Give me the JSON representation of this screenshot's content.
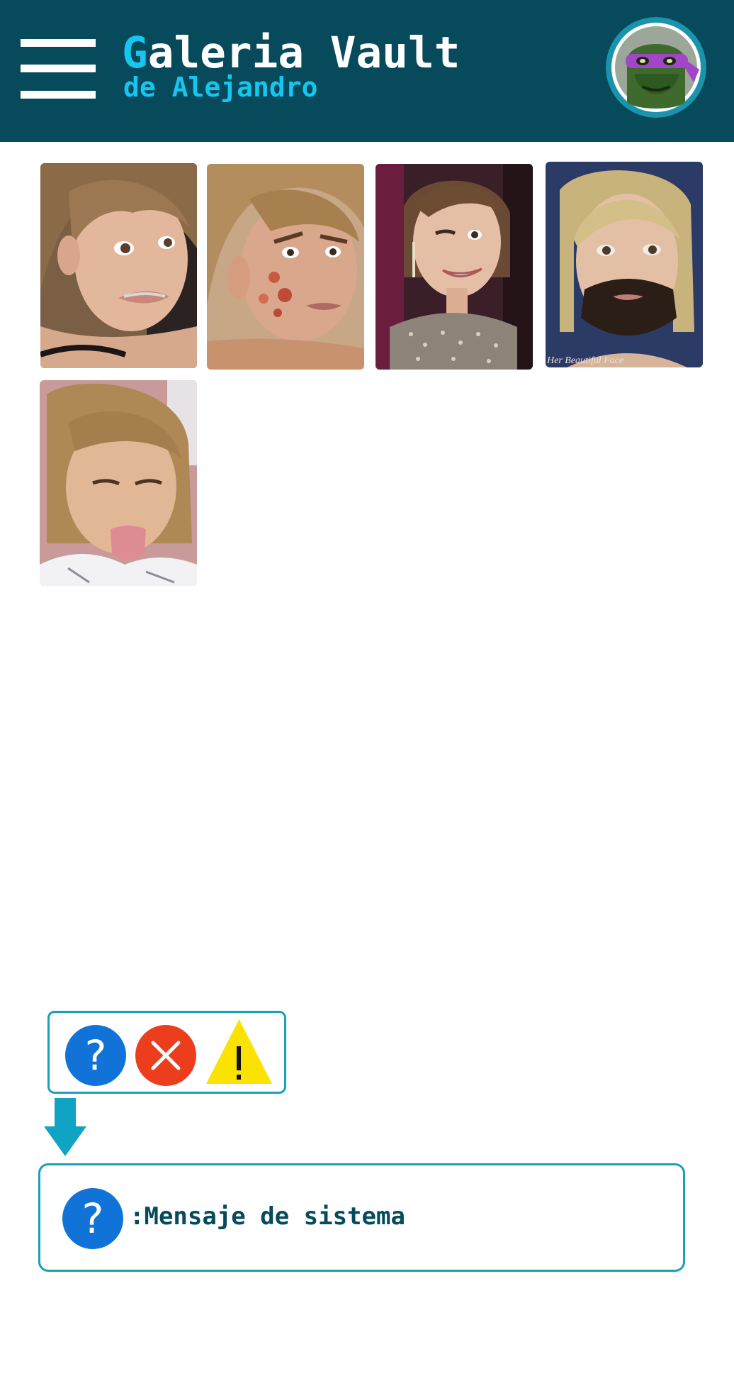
{
  "header": {
    "title_first_letter": "G",
    "title_rest": "aleria Vault",
    "subtitle": "de Alejandro",
    "background_color": "#064a5c",
    "accent_color": "#16c6ee"
  },
  "menu": {
    "icon": "hamburger-menu-icon"
  },
  "avatar": {
    "icon": "profile-avatar"
  },
  "gallery": {
    "items": [
      {
        "icon": "photo-thumbnail",
        "subject": "woman-with-braces-face"
      },
      {
        "icon": "photo-thumbnail",
        "subject": "woman-with-acne-face"
      },
      {
        "icon": "photo-thumbnail",
        "subject": "woman-winking-sequin-dress"
      },
      {
        "icon": "photo-thumbnail",
        "subject": "woman-with-beard-painting",
        "caption": "Her Beautiful Face"
      },
      {
        "icon": "photo-thumbnail",
        "subject": "woman-sticking-out-tongue"
      }
    ]
  },
  "alerts": {
    "question_icon": "question-icon",
    "error_icon": "error-x-icon",
    "warning_icon": "warning-icon",
    "question_color": "#1172d8",
    "error_color": "#ec3e1d",
    "warning_color": "#fce200"
  },
  "message": {
    "icon": "question-icon",
    "text": ":Mensaje de sistema"
  }
}
